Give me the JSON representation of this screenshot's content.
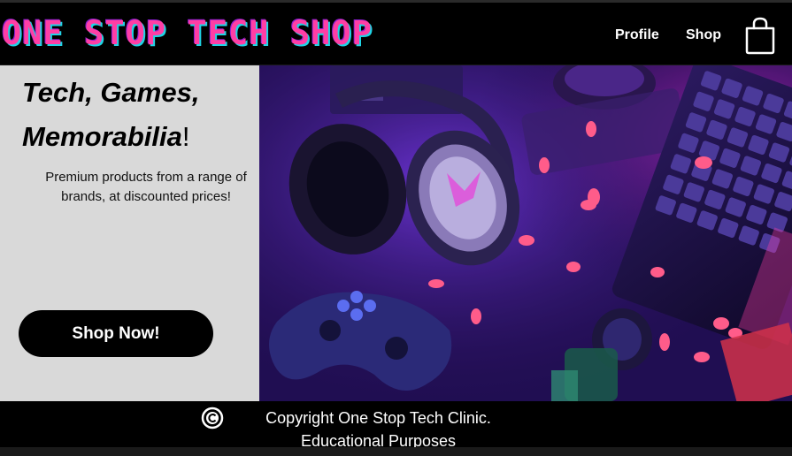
{
  "header": {
    "logo_text": "ONE STOP TECH SHOP",
    "nav": {
      "profile_label": "Profile",
      "shop_label": "Shop"
    },
    "cart_icon": "shopping-bag-icon"
  },
  "hero": {
    "headline_line1": "Tech, Games,",
    "headline_line2": "Memorabilia",
    "headline_exclaim": "!",
    "subtext": "Premium products from a range of brands, at discounted prices!",
    "cta_label": "Shop Now!",
    "image_alt": "Gaming headset, controller, keyboard and figure under purple neon light"
  },
  "footer": {
    "copyright_icon": "copyright-icon",
    "line1": "Copyright One Stop Tech Clinic.",
    "line2": "Educational Purposes"
  },
  "colors": {
    "logo_pink": "#ff3ea5",
    "logo_cyan": "#1fd5e6",
    "hero_left_bg": "#d9d9d9",
    "button_bg": "#000000",
    "neon_purple": "#8a2be2"
  }
}
